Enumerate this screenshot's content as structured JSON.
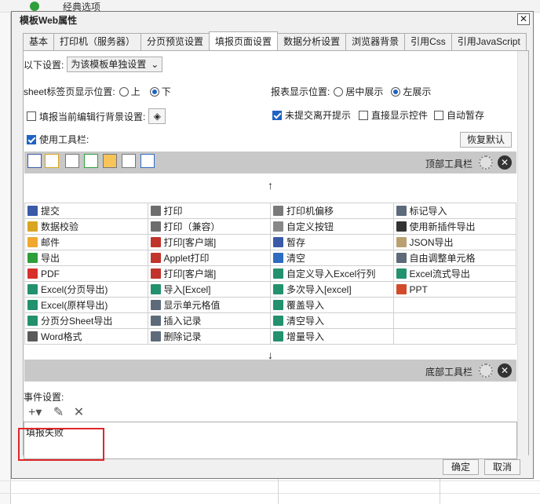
{
  "background": {
    "title": "经典选项"
  },
  "dialog": {
    "title": "模板Web属性",
    "close": "✕",
    "tabs": [
      "基本",
      "打印机（服务器）",
      "分页预览设置",
      "填报页面设置",
      "数据分析设置",
      "浏览器背景",
      "引用Css",
      "引用JavaScript"
    ],
    "active_tab": "填报页面设置"
  },
  "settings": {
    "mode_label": "以下设置:",
    "mode_value": "为该模板单独设置",
    "sheet_pos_label": "sheet标签页显示位置:",
    "sheet_up": "上",
    "sheet_down": "下",
    "report_pos_label": "报表显示位置:",
    "report_center": "居中展示",
    "report_left": "左展示",
    "edit_row_bg": "填报当前编辑行背景设置:",
    "unsubmitted_prompt": "未提交离开提示",
    "show_controls": "直接显示控件",
    "auto_save": "自动暂存",
    "use_toolbar": "使用工具栏:",
    "restore_default": "恢复默认"
  },
  "toolbar": {
    "top_label": "顶部工具栏",
    "bottom_label": "底部工具栏",
    "up_arrow": "↑",
    "down_arrow": "↓"
  },
  "buttons": [
    [
      "提交",
      "打印",
      "打印机偏移",
      "标记导入"
    ],
    [
      "数据校验",
      "打印（兼容）",
      "自定义按钮",
      "使用新插件导出"
    ],
    [
      "邮件",
      "打印[客户端]",
      "暂存",
      "JSON导出"
    ],
    [
      "导出",
      "Applet打印",
      "清空",
      "自由调整单元格"
    ],
    [
      "PDF",
      "打印[客户端]",
      "自定义导入Excel行列",
      "Excel流式导出"
    ],
    [
      "Excel(分页导出)",
      "导入[Excel]",
      "多次导入[excel]",
      "PPT"
    ],
    [
      "Excel(原样导出)",
      "显示单元格值",
      "覆盖导入",
      ""
    ],
    [
      "分页分Sheet导出",
      "插入记录",
      "清空导入",
      ""
    ],
    [
      "Word格式",
      "删除记录",
      "增量导入",
      ""
    ]
  ],
  "icon_colors": [
    [
      "#3a5aa8",
      "#6d6d6d",
      "#7b7b7b",
      "#5d6a7a"
    ],
    [
      "#d9a520",
      "#6d6d6d",
      "#888888",
      "#333333"
    ],
    [
      "#f0a830",
      "#c0342c",
      "#3a5aa8",
      "#b9a070"
    ],
    [
      "#2e9f3b",
      "#c0342c",
      "#2d6cc0",
      "#5d6a7a"
    ],
    [
      "#d7312c",
      "#c0342c",
      "#23906e",
      "#23906e"
    ],
    [
      "#23906e",
      "#23906e",
      "#23906e",
      "#d24a2a"
    ],
    [
      "#23906e",
      "#5d6a7a",
      "#23906e",
      ""
    ],
    [
      "#23906e",
      "#5d6a7a",
      "#23906e",
      ""
    ],
    [
      "#5a5a5a",
      "#5d6a7a",
      "#23906e",
      ""
    ]
  ],
  "events": {
    "label": "事件设置:",
    "add": "+▾",
    "edit": "✎",
    "delete": "✕",
    "item": "填报失败"
  },
  "footer": {
    "ok": "确定",
    "cancel": "取消"
  }
}
